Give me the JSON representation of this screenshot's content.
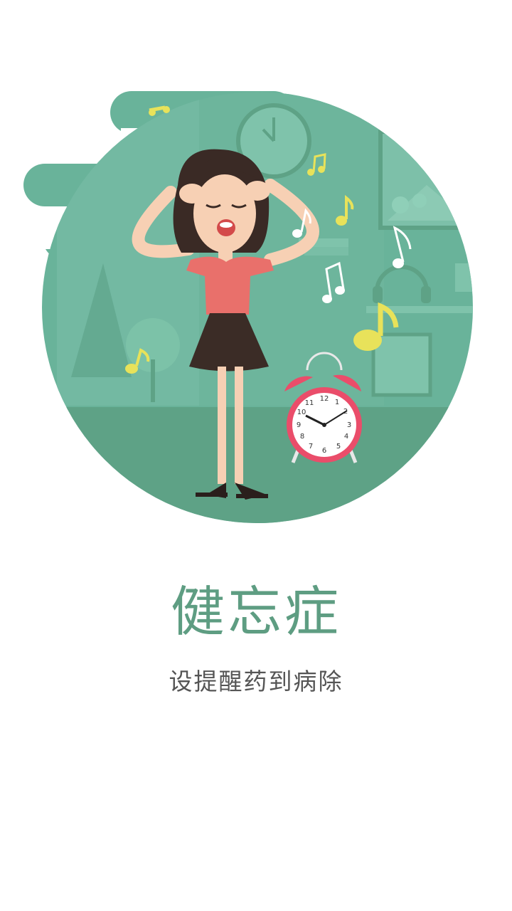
{
  "onboarding": {
    "title": "健忘症",
    "subtitle": "设提醒药到病除"
  },
  "illustration": {
    "description_icon": "forgetful-woman-alarm-clock-illustration",
    "clock_numbers": [
      "12",
      "1",
      "2",
      "3",
      "4",
      "5",
      "6",
      "7",
      "8",
      "9",
      "10",
      "11"
    ]
  },
  "colors": {
    "accent": "#5e9d82",
    "circle_bg": "#69b39a",
    "floor": "#5ea286",
    "skirt": "#3b2c26",
    "shirt": "#e9706b",
    "skin": "#f7d0b4",
    "hair": "#3a2a25",
    "note_yellow": "#e8e25a",
    "clock_red": "#ea4d6a"
  }
}
